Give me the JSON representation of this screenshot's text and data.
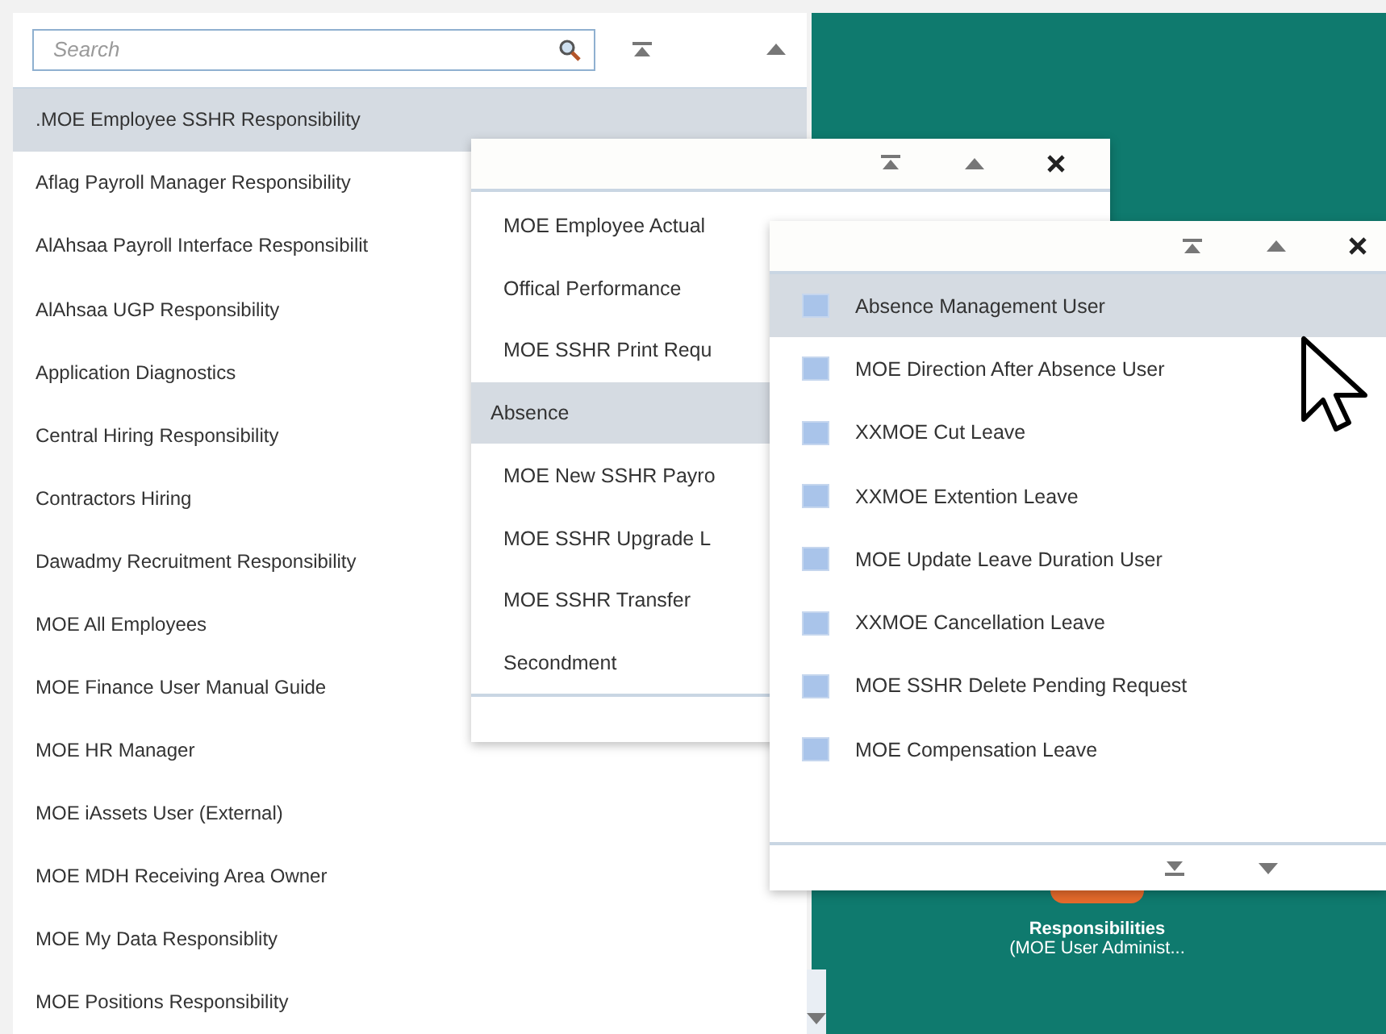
{
  "search": {
    "placeholder": "Search"
  },
  "responsibilities": [
    {
      "label": ".MOE Employee SSHR Responsibility",
      "selected": true
    },
    {
      "label": "Aflag Payroll Manager Responsibility",
      "selected": false
    },
    {
      "label": "AlAhsaa Payroll Interface Responsibilit",
      "selected": false
    },
    {
      "label": "AlAhsaa UGP Responsibility",
      "selected": false
    },
    {
      "label": "Application Diagnostics",
      "selected": false
    },
    {
      "label": "Central Hiring Responsibility",
      "selected": false
    },
    {
      "label": "Contractors Hiring",
      "selected": false
    },
    {
      "label": "Dawadmy Recruitment Responsibility",
      "selected": false
    },
    {
      "label": "MOE All Employees",
      "selected": false
    },
    {
      "label": "MOE Finance User Manual Guide",
      "selected": false
    },
    {
      "label": "MOE HR Manager",
      "selected": false
    },
    {
      "label": "MOE iAssets User (External)",
      "selected": false
    },
    {
      "label": "MOE MDH Receiving Area Owner",
      "selected": false
    },
    {
      "label": "MOE My Data Responsiblity",
      "selected": false
    },
    {
      "label": "MOE Positions Responsibility",
      "selected": false
    }
  ],
  "submenu": [
    {
      "label": "MOE Employee Actual",
      "selected": false
    },
    {
      "label": "Offical Performance",
      "selected": false
    },
    {
      "label": "MOE SSHR Print Requ",
      "selected": false
    },
    {
      "label": "Absence",
      "selected": true
    },
    {
      "label": "MOE New SSHR Payro",
      "selected": false
    },
    {
      "label": "MOE SSHR Upgrade L",
      "selected": false
    },
    {
      "label": "MOE SSHR Transfer",
      "selected": false
    },
    {
      "label": "Secondment",
      "selected": false
    }
  ],
  "functions": [
    {
      "label": "Absence Management User",
      "selected": true
    },
    {
      "label": "MOE Direction After Absence User",
      "selected": false
    },
    {
      "label": "XXMOE Cut Leave",
      "selected": false
    },
    {
      "label": "XXMOE Extention Leave",
      "selected": false
    },
    {
      "label": "MOE Update Leave Duration User",
      "selected": false
    },
    {
      "label": "XXMOE Cancellation Leave",
      "selected": false
    },
    {
      "label": "MOE SSHR Delete Pending Request",
      "selected": false
    },
    {
      "label": "MOE Compensation Leave",
      "selected": false
    }
  ],
  "tile": {
    "title": "Responsibilities",
    "subtitle": "(MOE User Administ..."
  }
}
